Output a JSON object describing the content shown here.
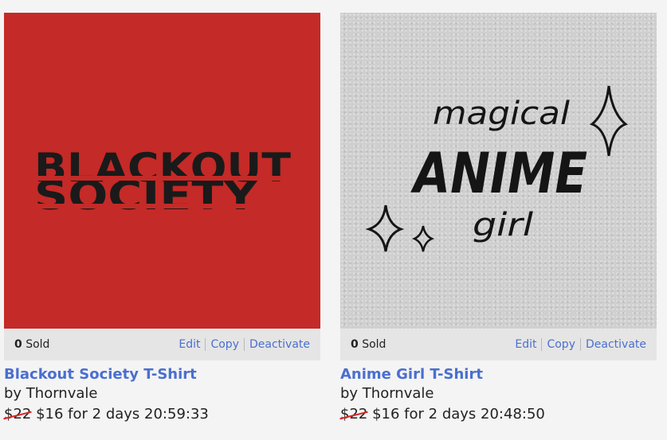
{
  "products": [
    {
      "image": {
        "alt": "Blackout Society design",
        "background": "#c42a27",
        "text_line_1": "BLACKOUT",
        "text_line_2": "SOCIETY"
      },
      "sold_count": "0",
      "sold_label": "Sold",
      "actions": {
        "edit": "Edit",
        "copy": "Copy",
        "deactivate": "Deactivate"
      },
      "title": "Blackout Society T-Shirt",
      "byline": "by Thornvale",
      "old_price": "$22",
      "price_text": "$16 for 2 days 20:59:33"
    },
    {
      "image": {
        "alt": "Magical Anime Girl design",
        "background": "#cfcfcf",
        "text_line_1": "magical",
        "text_line_2": "ANIME",
        "text_line_3": "girl"
      },
      "sold_count": "0",
      "sold_label": "Sold",
      "actions": {
        "edit": "Edit",
        "copy": "Copy",
        "deactivate": "Deactivate"
      },
      "title": "Anime Girl T-Shirt",
      "byline": "by Thornvale",
      "old_price": "$22",
      "price_text": "$16 for 2 days 20:48:50"
    }
  ],
  "colors": {
    "link": "#4a6fd0",
    "strike": "#dd2222",
    "bar": "#e5e5e5",
    "page": "#f4f4f4"
  }
}
